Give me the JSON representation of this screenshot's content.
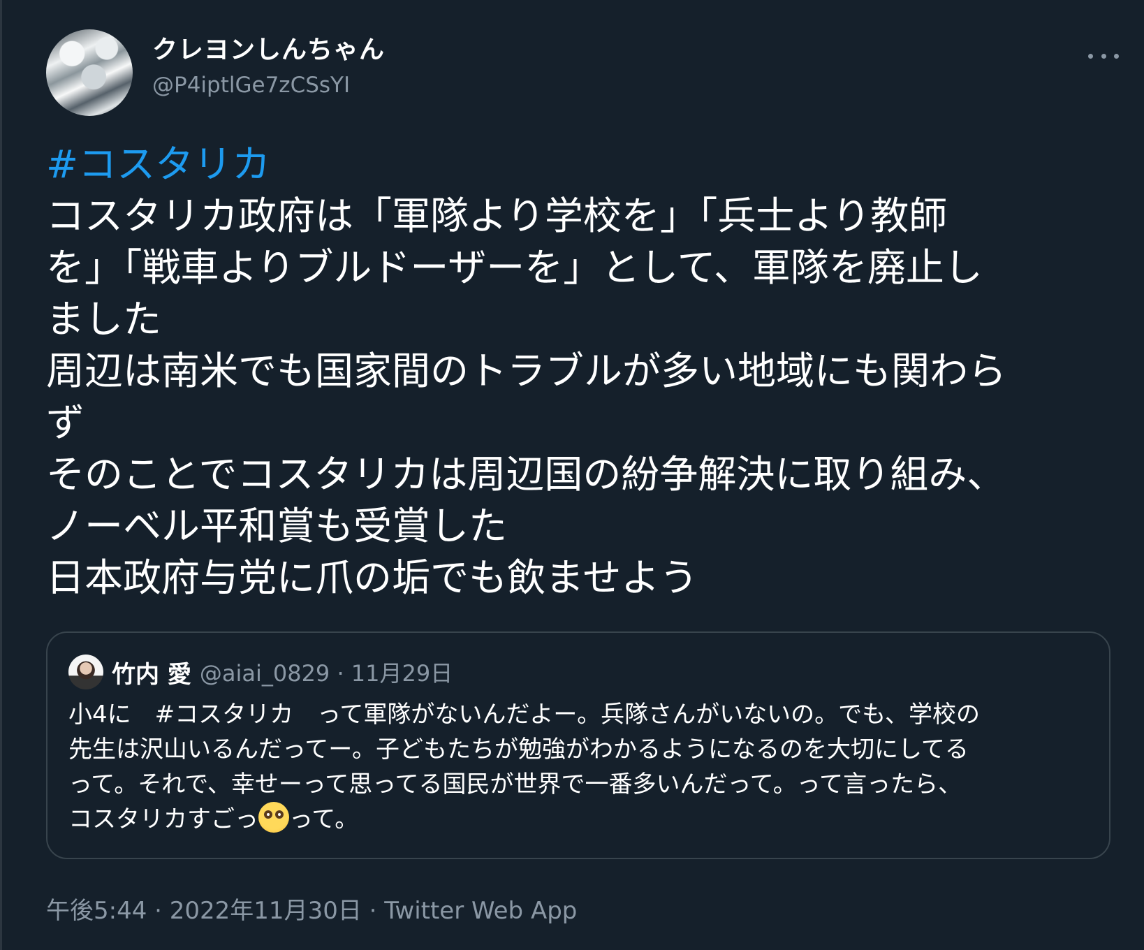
{
  "author": {
    "display_name": "クレヨンしんちゃん",
    "handle": "@P4iptlGe7zCSsYI"
  },
  "tweet": {
    "hashtag": "#コスタリカ",
    "lines": [
      "コスタリカ政府は「軍隊より学校を」「兵士より教師",
      "を」「戦車よりブルドーザーを」として、軍隊を廃止し",
      "ました",
      "周辺は南米でも国家間のトラブルが多い地域にも関わら",
      "ず",
      "そのことでコスタリカは周辺国の紛争解決に取り組み、",
      "ノーベル平和賞も受賞した",
      "日本政府与党に爪の垢でも飲ませよう"
    ]
  },
  "quote": {
    "name": "竹内 愛",
    "handle_date": "@aiai_0829 · 11月29日",
    "lines": [
      "小4に　#コスタリカ　って軍隊がないんだよー。兵隊さんがいないの。でも、学校の",
      "先生は沢山いるんだってー。子どもたちが勉強がわかるようになるのを大切にしてる",
      "って。それで、幸せーって思ってる国民が世界で一番多いんだって。って言ったら、"
    ],
    "last_line_before_emoji": "コスタリカすごっ",
    "emoji": "flushed-face",
    "last_line_after_emoji": "って。"
  },
  "meta": {
    "timestamp_source": "午後5:44 · 2022年11月30日 · Twitter Web App"
  },
  "colors": {
    "background": "#15202b",
    "hashtag": "#1d9bf0",
    "secondary_text": "#8b98a5",
    "border": "#38444d"
  }
}
